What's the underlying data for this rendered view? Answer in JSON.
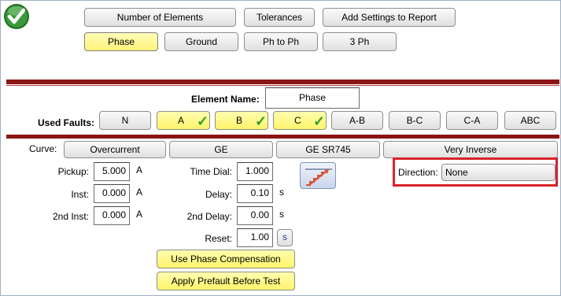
{
  "colors": {
    "accent_bar": "#8b1515",
    "selected_yellow": "#fff46a",
    "highlight_box": "#d8232a",
    "status_green": "#2d8a2d"
  },
  "status_icon": "green-checkmark-icon",
  "top_tabs": {
    "number_of_elements": "Number of Elements",
    "tolerances": "Tolerances",
    "add_settings": "Add Settings to Report"
  },
  "fault_types": {
    "phase": "Phase",
    "ground": "Ground",
    "ph_to_ph": "Ph to Ph",
    "three_ph": "3 Ph"
  },
  "element_name": {
    "label": "Element Name:",
    "value": "Phase"
  },
  "used_faults": {
    "label": "Used Faults:",
    "items": [
      {
        "label": "N",
        "checked": false
      },
      {
        "label": "A",
        "checked": true
      },
      {
        "label": "B",
        "checked": true
      },
      {
        "label": "C",
        "checked": true
      },
      {
        "label": "A-B",
        "checked": false
      },
      {
        "label": "B-C",
        "checked": false
      },
      {
        "label": "C-A",
        "checked": false
      },
      {
        "label": "ABC",
        "checked": false
      }
    ]
  },
  "curve": {
    "label": "Curve:",
    "type": "Overcurrent",
    "manufacturer": "GE",
    "model": "GE SR745",
    "curve_name": "Very Inverse"
  },
  "settings": {
    "pickup": {
      "label": "Pickup:",
      "value": "5.000",
      "unit": "A"
    },
    "inst": {
      "label": "Inst:",
      "value": "0.000",
      "unit": "A"
    },
    "second_inst": {
      "label": "2nd Inst:",
      "value": "0.000",
      "unit": "A"
    },
    "time_dial": {
      "label": "Time Dial:",
      "value": "1.000"
    },
    "delay": {
      "label": "Delay:",
      "value": "0.10",
      "unit": "s"
    },
    "second_delay": {
      "label": "2nd Delay:",
      "value": "0.00",
      "unit": "s"
    },
    "reset": {
      "label": "Reset:",
      "value": "1.00",
      "unit_button": "s"
    }
  },
  "direction": {
    "label": "Direction:",
    "value": "None"
  },
  "actions": {
    "phase_comp": "Use Phase Compensation",
    "prefault": "Apply Prefault Before Test"
  }
}
